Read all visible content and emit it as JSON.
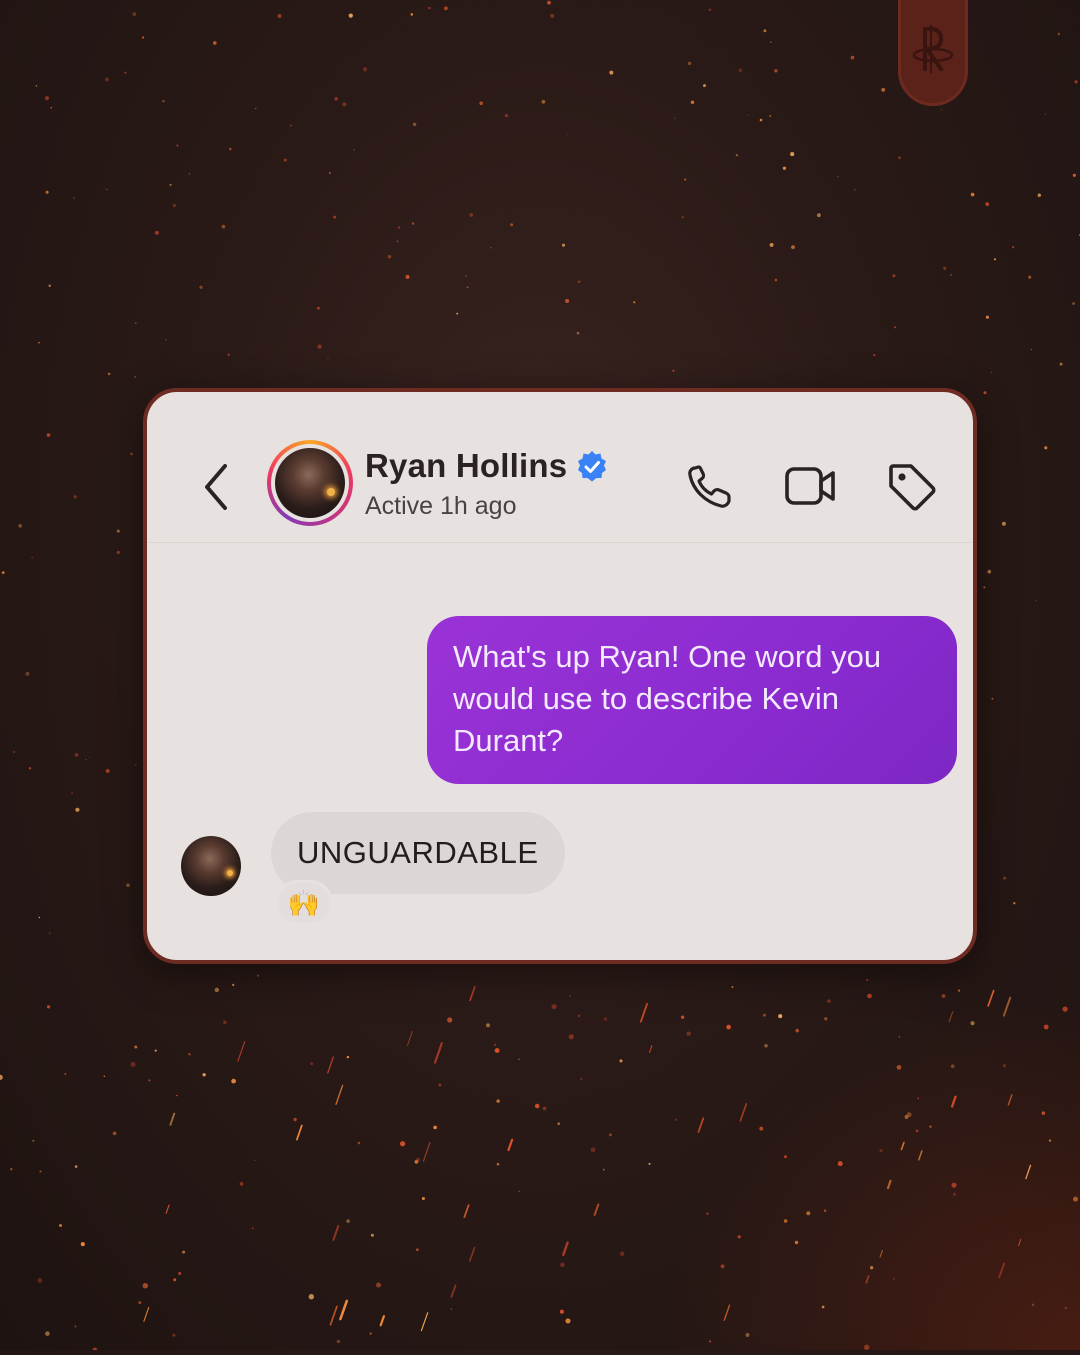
{
  "chat_header": {
    "back_icon": "chevron-left-icon",
    "contact_name": "Ryan Hollins",
    "verified_icon": "verified-badge-icon",
    "status": "Active 1h ago",
    "actions": [
      "phone-icon",
      "video-camera-icon",
      "tag-icon"
    ]
  },
  "messages": {
    "outgoing": "What's up Ryan! One word you would use to describe Kevin Durant?",
    "incoming": "UNGUARDABLE",
    "reaction": "🙌"
  },
  "colors": {
    "outgoing_bubble": "#8a2bd0",
    "incoming_bubble": "#dcd7d5",
    "card_background": "#e7e2e0",
    "verified_blue": "#3b82f6",
    "page_background": "#2a1a17",
    "card_border": "#6d2b22"
  }
}
